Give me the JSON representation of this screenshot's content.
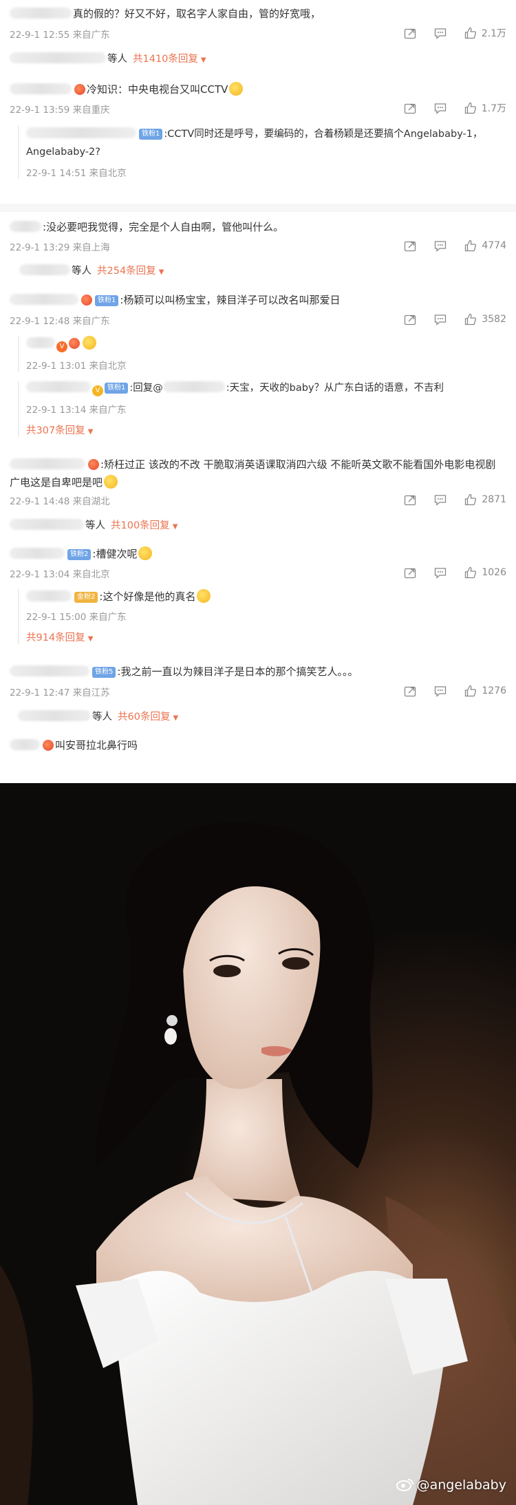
{
  "comments": [
    {
      "text": "真的假的？好又不好，取名字人家自由，管的好宽哦，",
      "time": "22-9-1 12:55 来自广东",
      "likes": "2.1万",
      "more_suffix": "等人",
      "more_count": "共1410条回复"
    },
    {
      "text": "冷知识：中央电视台又叫CCTV",
      "time": "22-9-1 13:59 来自重庆",
      "likes": "1.7万",
      "badge": "铁粉1",
      "reply_text": "CCTV同时还是呼号，要编码的，合着杨颖是还要搞个Angelababy-1，Angelababy-2?",
      "reply_time": "22-9-1 14:51 来自北京"
    },
    {
      "text": "没必要吧我觉得，完全是个人自由啊，管他叫什么。",
      "time": "22-9-1 13:29 来自上海",
      "likes": "4774",
      "more_suffix": "等人",
      "more_count": "共254条回复"
    },
    {
      "badge": "铁粉1",
      "text": "杨颖可以叫杨宝宝，辣目洋子可以改名叫那爱日",
      "time": "22-9-1 12:48 来自广东",
      "likes": "3582",
      "reply1_time": "22-9-1 13:01 来自北京",
      "reply2_badge": "铁粉1",
      "reply2_prefix": "回复@",
      "reply2_text": "天宝，天收的baby？从广东白话的语意，不吉利",
      "reply2_time": "22-9-1 13:14 来自广东",
      "more_count": "共307条回复"
    },
    {
      "text": "矫枉过正 该改的不改 干脆取消英语课取消四六级 不能听英文歌不能看国外电影电视剧 广电这是自卑吧是吧",
      "time": "22-9-1 14:48 来自湖北",
      "likes": "2871",
      "more_suffix": "等人",
      "more_count": "共100条回复"
    },
    {
      "badge": "铁粉2",
      "text": "槽健次呢",
      "time": "22-9-1 13:04 来自北京",
      "likes": "1026",
      "reply_badge": "金粉2",
      "reply_text": "这个好像是他的真名",
      "reply_time": "22-9-1 15:00 来自广东",
      "more_count": "共914条回复"
    },
    {
      "badge": "铁粉5",
      "text": "我之前一直以为辣目洋子是日本的那个搞笑艺人。。。",
      "time": "22-9-1 12:47 来自江苏",
      "likes": "1276",
      "more_suffix": "等人",
      "more_count": "共60条回复"
    },
    {
      "text": "叫安哥拉北鼻行吗"
    }
  ],
  "photo": {
    "watermark": "@angelababy",
    "weibo_logo": "weibo-logo-icon"
  },
  "colors": {
    "accent": "#eb7350",
    "meta": "#999999",
    "fan_badge": "#6fa4e6",
    "gold_badge": "#f0b440"
  }
}
